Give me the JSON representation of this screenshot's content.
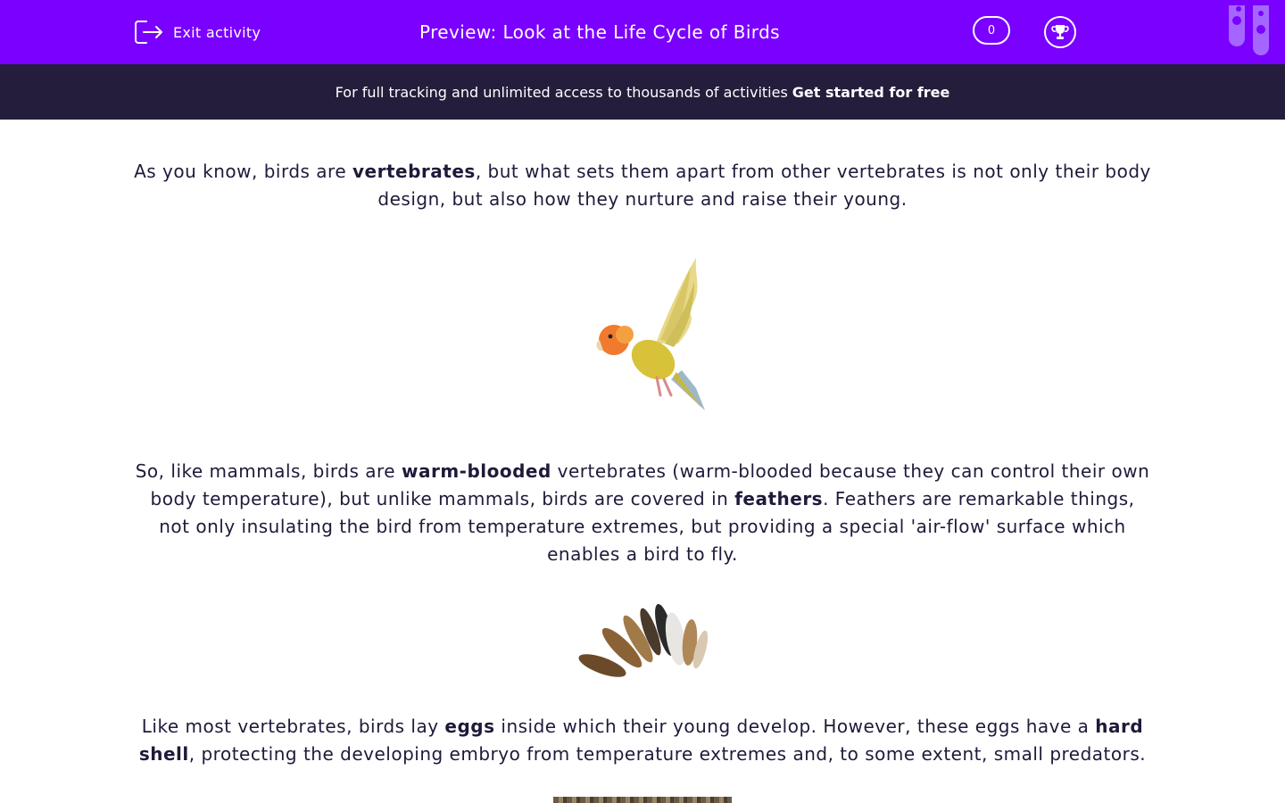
{
  "header": {
    "exit_label": "Exit activity",
    "title": "Preview: Look at the Life Cycle of Birds",
    "score": "0"
  },
  "banner": {
    "text": "For full tracking and unlimited access to thousands of activities",
    "cta": "Get started for free"
  },
  "content": {
    "p1": {
      "a": "As you know, birds are ",
      "b": "vertebrates",
      "c": ", but what sets them apart from other vertebrates is not only their body design, but also how they nurture and raise their young."
    },
    "p2": {
      "a": "So, like mammals, birds are ",
      "b": "warm-blooded",
      "c": " vertebrates (warm-blooded because they can control their own body temperature), but unlike mammals, birds are covered in ",
      "d": "feathers",
      "e": ". Feathers are remarkable things, not only insulating the bird from temperature extremes, but providing a special 'air-flow' surface which enables a bird to fly."
    },
    "p3": {
      "a": "Like most vertebrates, birds lay ",
      "b": "eggs",
      "c": " inside which their young develop. However, these eggs have a ",
      "d": "hard shell",
      "e": ", protecting the developing embryo from temperature extremes and, to some extent, small predators."
    }
  },
  "colors": {
    "brand_purple": "#7a00ff",
    "banner_dark": "#241d3b",
    "text_dark": "#1f1a3a"
  },
  "icons": [
    "exit-icon",
    "trophy-icon",
    "test-tubes-icon"
  ]
}
